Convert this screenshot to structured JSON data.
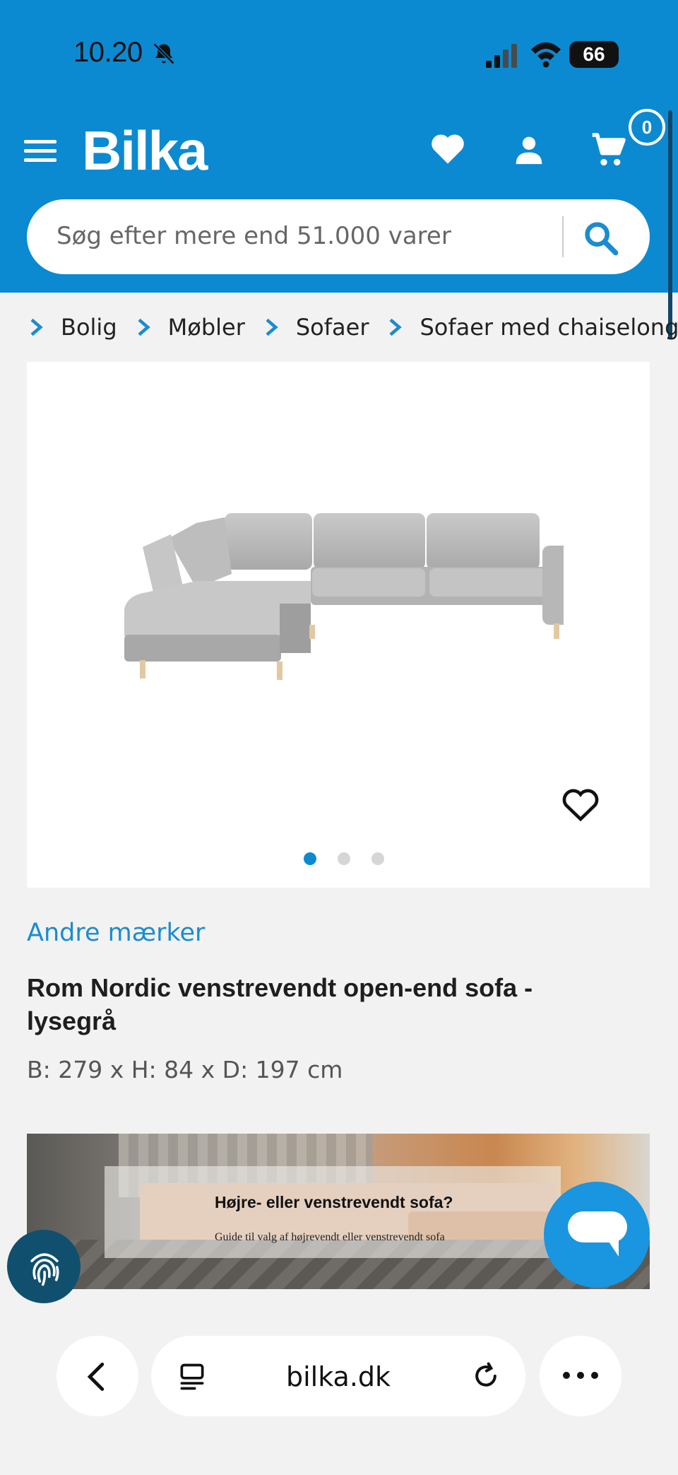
{
  "status_bar": {
    "time": "10.20",
    "battery": "66"
  },
  "header": {
    "logo": "Bilka",
    "cart_count": "0",
    "brand_color": "#0b8ad1"
  },
  "search": {
    "placeholder": "Søg efter mere end 51.000 varer"
  },
  "breadcrumb": [
    "Bolig",
    "Møbler",
    "Sofaer",
    "Sofaer med chaiselong"
  ],
  "product": {
    "brand": "Andre mærker",
    "title": "Rom Nordic venstrevendt open-end sofa - lysegrå",
    "dimensions": "B: 279 x H: 84 x D: 197 cm",
    "gallery_dots": 3,
    "gallery_active": 1
  },
  "promo": {
    "title": "Højre- eller venstrevendt sofa?",
    "subtitle": "Guide til valg af højrevendt eller venstrevendt sofa"
  },
  "browser": {
    "url": "bilka.dk"
  },
  "icons": {
    "menu": "menu-icon",
    "favorite": "heart-icon",
    "account": "user-icon",
    "cart": "cart-icon",
    "search": "search-icon",
    "chat": "chat-icon",
    "fingerprint": "fingerprint-icon",
    "back": "chevron-left-icon",
    "tabs": "tabs-icon",
    "reload": "reload-icon",
    "more": "more-icon"
  }
}
